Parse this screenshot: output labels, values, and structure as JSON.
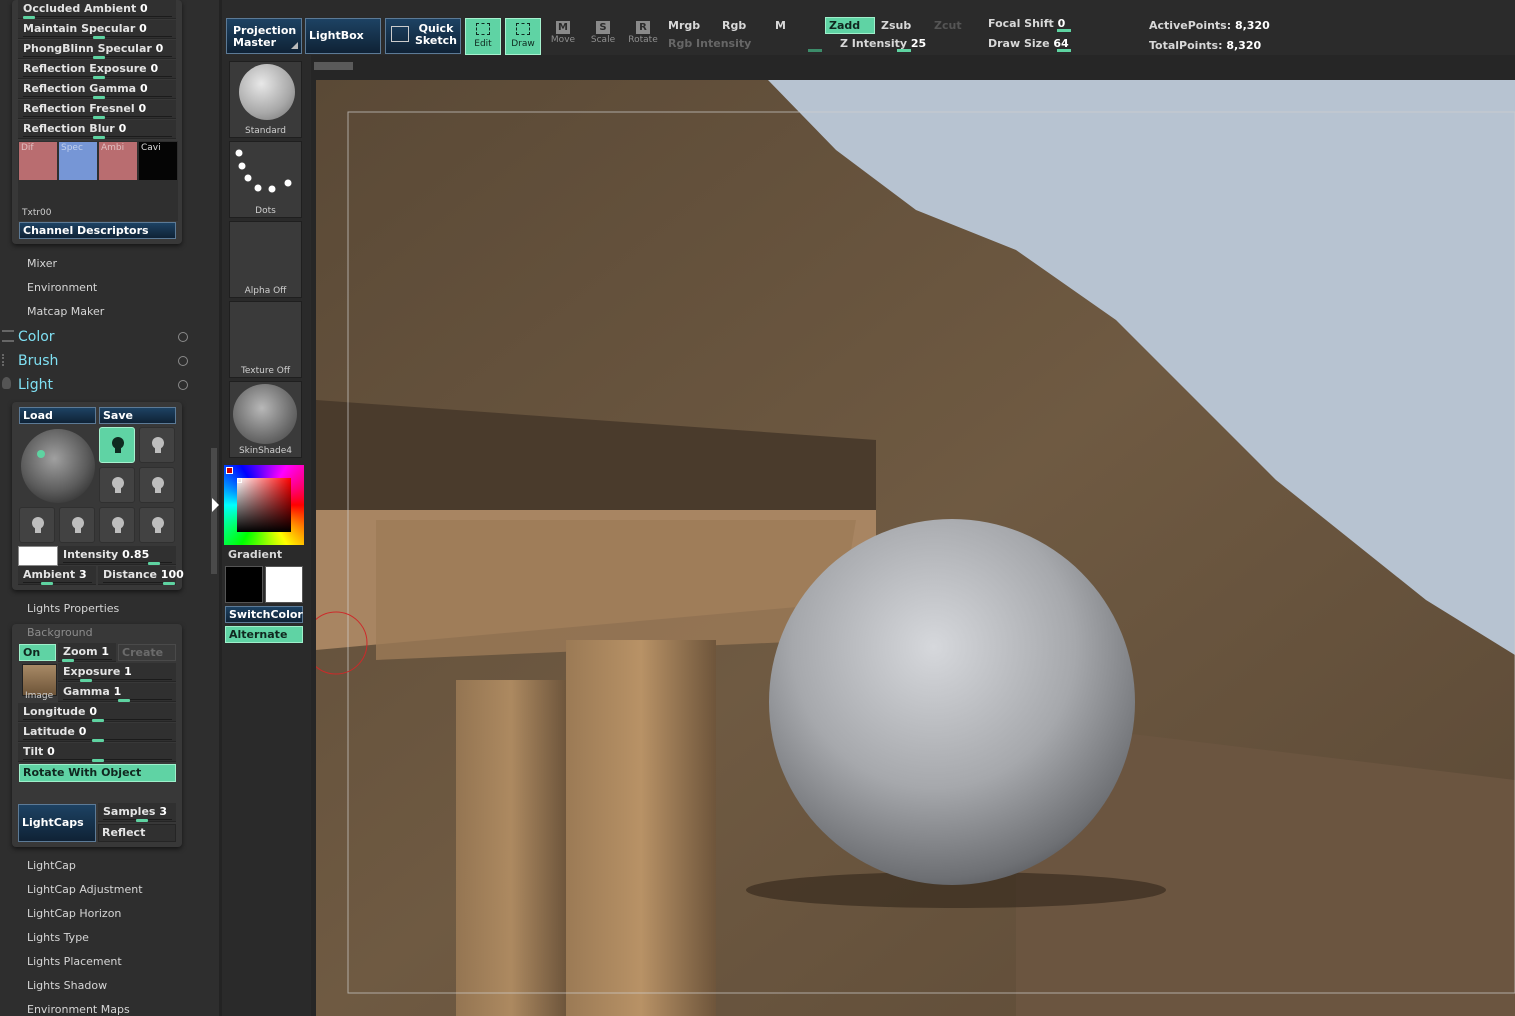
{
  "material_panel": {
    "sliders": [
      {
        "label": "Occluded  Ambient",
        "value": "0",
        "fraction": 0.0
      },
      {
        "label": "Maintain Specular",
        "value": "0",
        "fraction": 0.5
      },
      {
        "label": "PhongBlinn Specular",
        "value": "0",
        "fraction": 0.5
      },
      {
        "label": "Reflection Exposure",
        "value": "0",
        "fraction": 0.5
      },
      {
        "label": "Reflection Gamma",
        "value": "0",
        "fraction": 0.5
      },
      {
        "label": "Reflection Fresnel",
        "value": "0",
        "fraction": 0.5
      },
      {
        "label": "Reflection Blur",
        "value": "0",
        "fraction": 0.5
      }
    ],
    "channels": [
      {
        "label": "Dif",
        "color": "#b96d70"
      },
      {
        "label": "Spec",
        "color": "#7696d6"
      },
      {
        "label": "Ambi",
        "color": "#b96d70"
      },
      {
        "label": "Cavi",
        "color": "#050505"
      }
    ],
    "texture_label": "Txtr00",
    "channel_descriptors_label": "Channel Descriptors"
  },
  "sub_menus_top": [
    "Mixer",
    "Environment",
    "Matcap Maker"
  ],
  "palettes": [
    "Color",
    "Brush",
    "Light"
  ],
  "light_panel": {
    "load_label": "Load",
    "save_label": "Save",
    "intensity": {
      "label": "Intensity",
      "value": "0.85",
      "fraction": 0.85
    },
    "ambient": {
      "label": "Ambient",
      "value": "3",
      "fraction": 0.3
    },
    "distance": {
      "label": "Distance",
      "value": "100",
      "fraction": 1.0
    }
  },
  "lights_properties_label": "Lights Properties",
  "background_panel": {
    "title": "Background",
    "on_label": "On",
    "zoom": {
      "label": "Zoom",
      "value": "1"
    },
    "create_label": "Create",
    "exposure": {
      "label": "Exposure",
      "value": "1"
    },
    "gamma": {
      "label": "Gamma",
      "value": "1"
    },
    "image_label": "Image",
    "longitude": {
      "label": "Longitude",
      "value": "0"
    },
    "latitude": {
      "label": "Latitude",
      "value": "0"
    },
    "tilt": {
      "label": "Tilt",
      "value": "0"
    },
    "rotate_label": "Rotate With Object",
    "lightcaps_label": "LightCaps",
    "samples": {
      "label": "Samples",
      "value": "3"
    },
    "reflect_label": "Reflect"
  },
  "sub_menus_bottom": [
    "LightCap",
    "LightCap Adjustment",
    "LightCap Horizon",
    "Lights Type",
    "Lights Placement",
    "Lights Shadow",
    "Environment Maps"
  ],
  "shelf": {
    "brush": "Standard",
    "stroke": "Dots",
    "alpha": "Alpha  Off",
    "texture": "Texture  Off",
    "material": "SkinShade4",
    "gradient_label": "Gradient",
    "switch_color_label": "SwitchColor",
    "alternate_label": "Alternate"
  },
  "top_bar": {
    "projection_master": "Projection Master",
    "lightbox": "LightBox",
    "quick_sketch": "Quick Sketch",
    "tools": [
      {
        "label": "Edit",
        "letter": "",
        "active": true
      },
      {
        "label": "Draw",
        "letter": "",
        "active": true
      },
      {
        "label": "Move",
        "letter": "M",
        "active": false
      },
      {
        "label": "Scale",
        "letter": "S",
        "active": false
      },
      {
        "label": "Rotate",
        "letter": "R",
        "active": false
      }
    ],
    "mrgb": "Mrgb",
    "rgb": "Rgb",
    "m": "M",
    "rgb_intensity": "Rgb  Intensity",
    "zadd": "Zadd",
    "zsub": "Zsub",
    "zcut": "Zcut",
    "z_intensity": {
      "label": "Z  Intensity",
      "value": "25"
    },
    "focal_shift": {
      "label": "Focal  Shift",
      "value": "0"
    },
    "draw_size": {
      "label": "Draw  Size",
      "value": "64"
    },
    "active_points": {
      "label": "ActivePoints:",
      "value": "8,320"
    },
    "total_points": {
      "label": "TotalPoints:",
      "value": "8,320"
    }
  },
  "icons": [
    "bulb-icon",
    "edit-icon",
    "draw-icon",
    "move-icon",
    "scale-icon",
    "rotate-icon",
    "quick-sketch-icon",
    "palette-popout-icon"
  ]
}
